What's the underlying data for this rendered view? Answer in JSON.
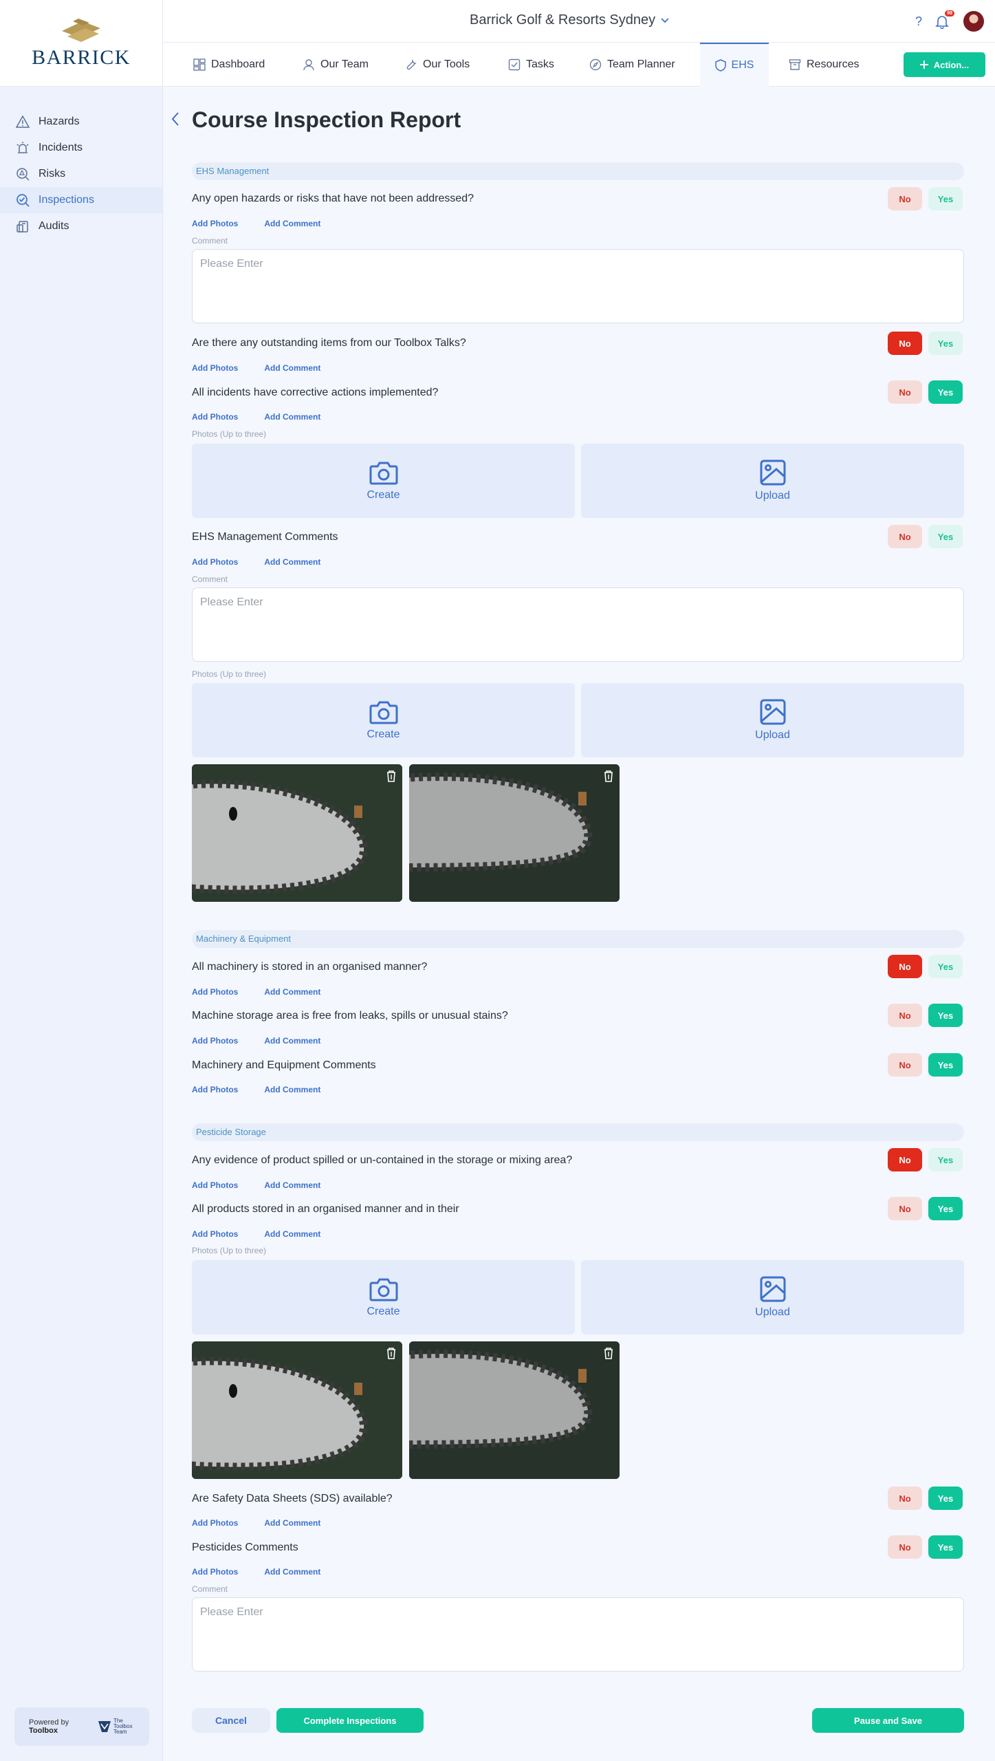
{
  "brand": {
    "logo_text": "BARRICK"
  },
  "header": {
    "venue": "Barrick Golf & Resorts Sydney",
    "notification_count": "99"
  },
  "sidebar": {
    "items": [
      {
        "label": "Hazards",
        "icon": "warning-triangle-icon"
      },
      {
        "label": "Incidents",
        "icon": "alarm-light-icon"
      },
      {
        "label": "Risks",
        "icon": "magnifier-alert-icon"
      },
      {
        "label": "Inspections",
        "icon": "magnifier-check-icon",
        "active": true
      },
      {
        "label": "Audits",
        "icon": "clipboard-icon"
      }
    ],
    "powered_by": {
      "line1": "Powered by",
      "line2": "Toolbox",
      "partner": "The Toolbox Team"
    }
  },
  "tabs": [
    {
      "label": "Dashboard"
    },
    {
      "label": "Our Team"
    },
    {
      "label": "Our Tools"
    },
    {
      "label": "Tasks"
    },
    {
      "label": "Team Planner"
    },
    {
      "label": "EHS",
      "active": true
    },
    {
      "label": "Resources"
    }
  ],
  "action_button": "Action...",
  "page": {
    "title": "Course Inspection Report"
  },
  "labels": {
    "add_photos": "Add Photos",
    "add_comment": "Add Comment",
    "no": "No",
    "yes": "Yes",
    "comment": "Comment",
    "comment_placeholder": "Please Enter",
    "photos_hint": "Photos (Up to three)",
    "create": "Create",
    "upload": "Upload"
  },
  "sections": [
    {
      "title": "EHS Management",
      "questions": [
        {
          "text": "Any open hazards or risks that have not been addressed?",
          "answer": "none"
        },
        {
          "text": "Are there any outstanding items from our Toolbox Talks?",
          "answer": "no"
        },
        {
          "text": "All incidents have corrective actions implemented?",
          "answer": "yes"
        },
        {
          "text": "EHS Management Comments",
          "answer": "none"
        }
      ]
    },
    {
      "title": "Machinery & Equipment",
      "questions": [
        {
          "text": "All machinery is stored in an organised manner?",
          "answer": "no"
        },
        {
          "text": "Machine storage area is free from leaks, spills or unusual stains?",
          "answer": "yes"
        },
        {
          "text": "Machinery and Equipment Comments",
          "answer": "yes"
        }
      ]
    },
    {
      "title": "Pesticide Storage",
      "questions": [
        {
          "text": "Any evidence of product spilled or un-contained in the storage or mixing area?",
          "answer": "no"
        },
        {
          "text": "All products stored in an organised manner and in their",
          "answer": "yes"
        },
        {
          "text": "Are Safety Data Sheets (SDS) available?",
          "answer": "yes"
        },
        {
          "text": "Pesticides Comments",
          "answer": "yes"
        }
      ]
    }
  ],
  "footer": {
    "cancel": "Cancel",
    "complete": "Complete Inspections",
    "pause": "Pause and Save"
  }
}
